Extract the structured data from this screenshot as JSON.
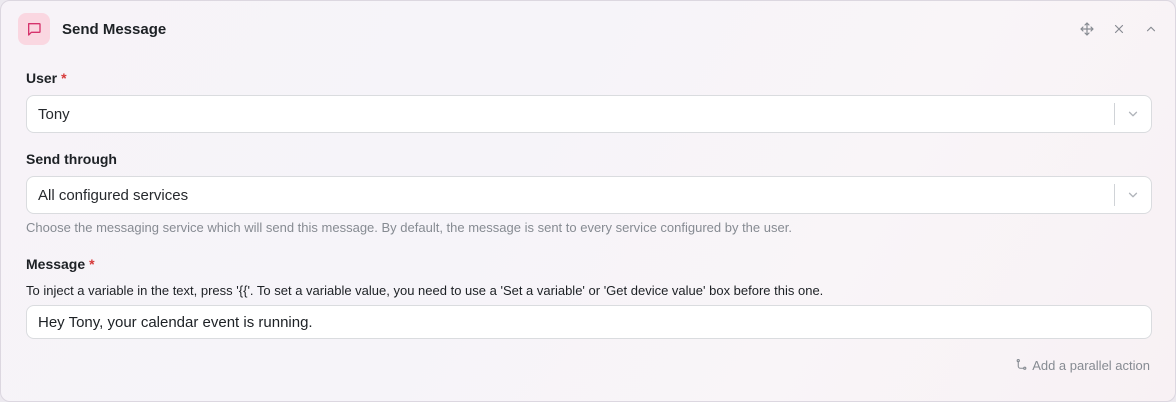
{
  "header": {
    "title": "Send Message",
    "icon": "message-icon",
    "icon_color": "#d6336c",
    "icon_bg": "#fad7e1",
    "actions": [
      "move-icon",
      "close-icon",
      "chevron-up-icon"
    ]
  },
  "user_field": {
    "label": "User",
    "required_mark": "*",
    "value": "Tony"
  },
  "send_through_field": {
    "label": "Send through",
    "value": "All configured services",
    "hint": "Choose the messaging service which will send this message. By default, the message is sent to every service configured by the user."
  },
  "message_field": {
    "label": "Message",
    "required_mark": "*",
    "help": "To inject a variable in the text, press '{{'. To set a variable value, you need to use a 'Set a variable' or 'Get device value' box before this one.",
    "value": "Hey Tony, your calendar event is running."
  },
  "footer": {
    "parallel_action_label": "Add a parallel action",
    "icon": "branch-icon"
  },
  "colors": {
    "required": "#d63939",
    "hint_text": "#868b92"
  }
}
